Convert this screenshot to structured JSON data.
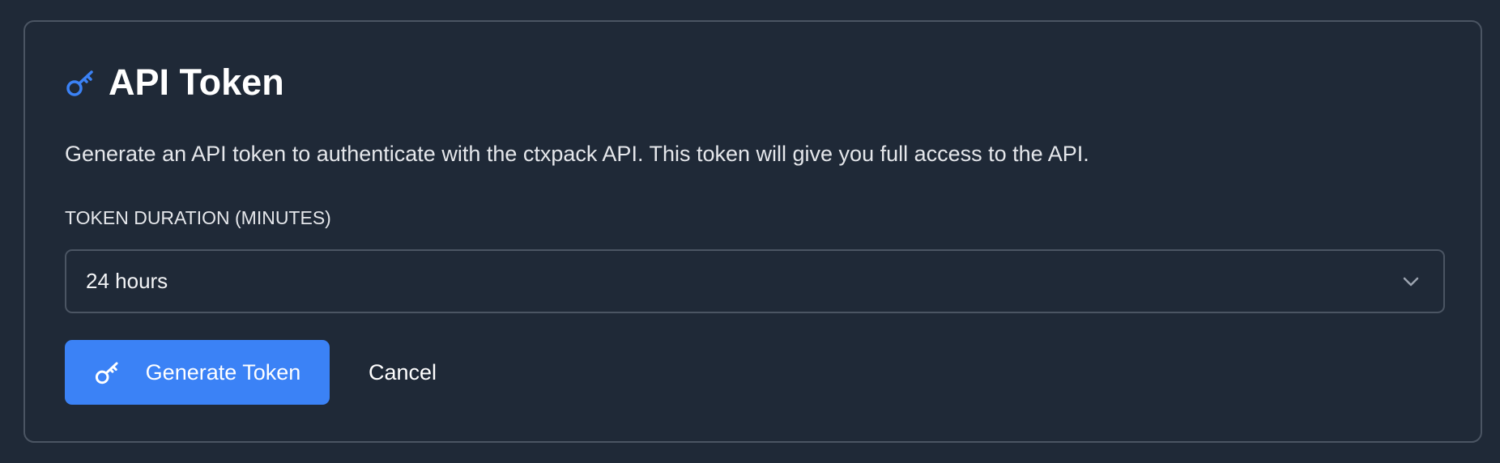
{
  "card": {
    "title": "API Token",
    "title_icon": "key-icon",
    "description": "Generate an API token to authenticate with the ctxpack API. This token will give you full access to the API."
  },
  "duration_field": {
    "label": "TOKEN DURATION (MINUTES)",
    "selected_value": "24 hours",
    "dropdown_icon": "chevron-down-icon"
  },
  "actions": {
    "generate_label": "Generate Token",
    "generate_icon": "key-icon",
    "cancel_label": "Cancel"
  },
  "colors": {
    "background": "#1f2937",
    "border": "#4b5563",
    "accent": "#3b82f6",
    "title_icon": "#3b82f6",
    "text": "#ffffff"
  }
}
